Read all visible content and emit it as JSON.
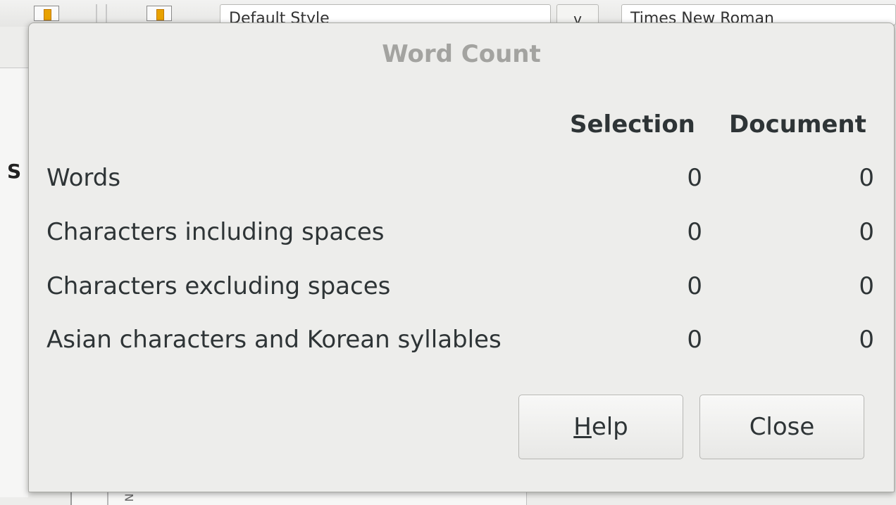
{
  "background": {
    "paragraph_style": "Default Style",
    "dropdown_arrow": "v",
    "font_name": "Times New Roman",
    "sidebar_letter": "S",
    "ruler_glyph": "N"
  },
  "dialog": {
    "title": "Word Count",
    "columns": {
      "selection": "Selection",
      "document": "Document"
    },
    "rows": [
      {
        "label": "Words",
        "selection": "0",
        "document": "0"
      },
      {
        "label": "Characters including spaces",
        "selection": "0",
        "document": "0"
      },
      {
        "label": "Characters excluding spaces",
        "selection": "0",
        "document": "0"
      },
      {
        "label": "Asian characters and Korean syllables",
        "selection": "0",
        "document": "0"
      }
    ],
    "buttons": {
      "help_mnemonic": "H",
      "help_rest": "elp",
      "close": "Close"
    }
  },
  "colors": {
    "title_text": "#a3a3a0",
    "dialog_bg": "#ededeb",
    "text": "#2e3436"
  }
}
